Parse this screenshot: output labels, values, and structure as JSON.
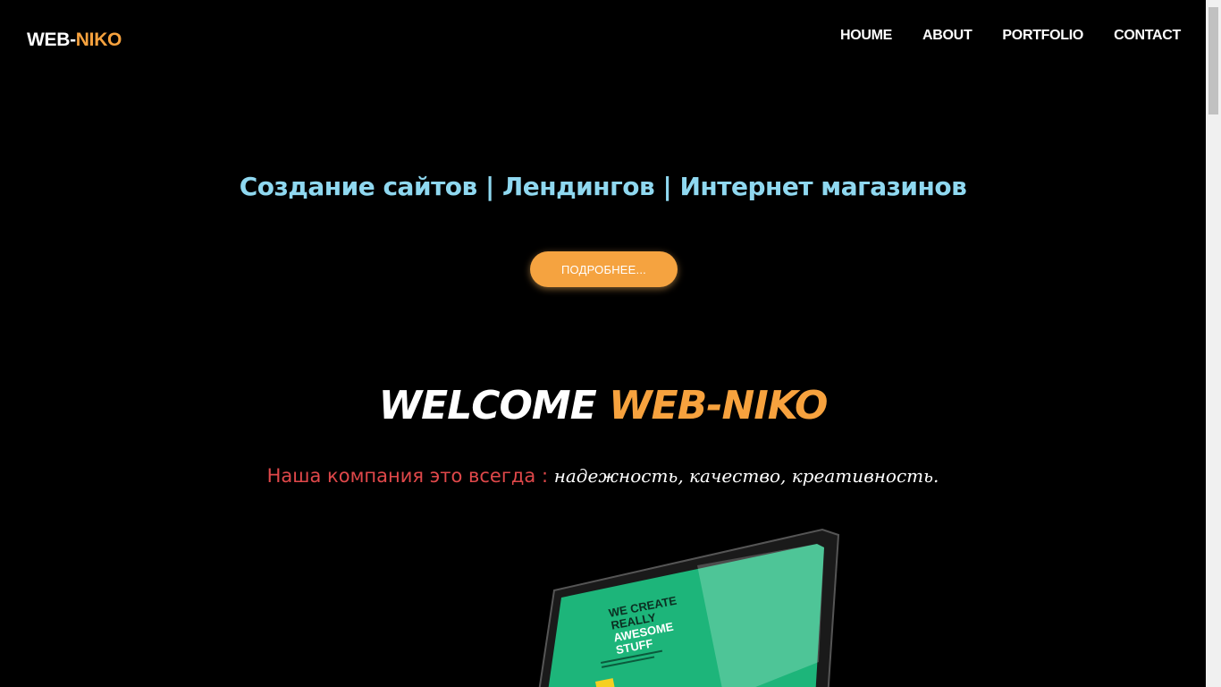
{
  "header": {
    "logo_part1": "WEB-",
    "logo_part2": "NIKO",
    "nav": [
      "HOUME",
      "ABOUT",
      "PORTFOLIO",
      "CONTACT"
    ]
  },
  "hero": {
    "subtitle": "Создание сайтов | Лендингов | Интернет магазинов",
    "button_label": "ПОДРОБНЕЕ..."
  },
  "welcome": {
    "part1": "WELCOME",
    "part2": "WEB-NIKO"
  },
  "tagline": {
    "red_text": "Наша компания это всегда :",
    "white_text": "надежность, качество, креативность."
  },
  "laptop_screen": {
    "headline_lines": [
      "WE CREATE",
      "REALLY",
      "AWESOME",
      "STUFF"
    ]
  },
  "colors": {
    "accent": "#f7a23e",
    "subtitle": "#8fd8f0",
    "tagline_red": "#e0484a",
    "laptop_screen": "#1db57a"
  }
}
